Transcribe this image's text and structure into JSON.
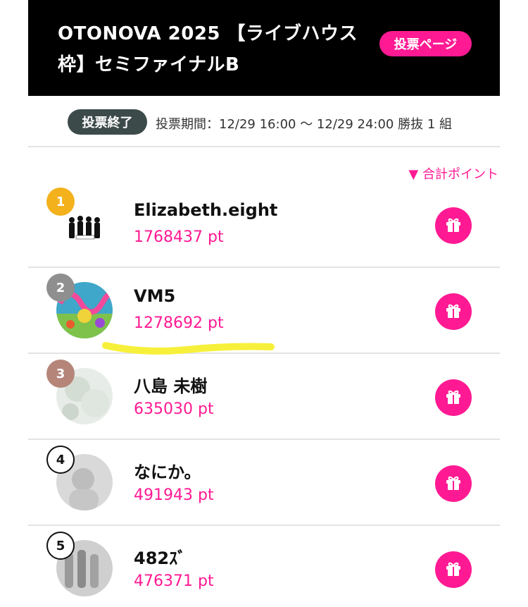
{
  "header": {
    "title": "OTONOVA 2025 【ライブハウス枠】セミファイナルB",
    "vote_page_label": "投票ページ"
  },
  "status": {
    "badge": "投票終了",
    "period": "投票期間：12/29 16:00 〜 12/29 24:00  勝抜 1 組"
  },
  "sort": {
    "label": "▼ 合計ポイント"
  },
  "ranking": [
    {
      "rank": "1",
      "name": "Elizabeth.eight",
      "points": "1768437 pt",
      "badge_style": "gold",
      "avatar_image": "band-photo"
    },
    {
      "rank": "2",
      "name": "VM5",
      "points": "1278692 pt",
      "badge_style": "silver",
      "avatar_image": "colorful-logo"
    },
    {
      "rank": "3",
      "name": "八島 未樹",
      "points": "635030 pt",
      "badge_style": "bronze",
      "avatar_image": "faded-photo"
    },
    {
      "rank": "4",
      "name": "なにか。",
      "points": "491943 pt",
      "badge_style": "plain",
      "avatar_image": "blurred-photo"
    },
    {
      "rank": "5",
      "name": "482ｽﾞ",
      "points": "476371 pt",
      "badge_style": "plain",
      "avatar_image": "group-photo"
    }
  ],
  "colors": {
    "accent": "#ff1a93",
    "header_bg": "#000000",
    "status_badge_bg": "#3d4a4a",
    "gold": "#f3b11c",
    "silver": "#8f8f8f",
    "bronze": "#b5857a",
    "highlight": "#f7f03a"
  },
  "icons": {
    "gift": "gift-icon"
  }
}
